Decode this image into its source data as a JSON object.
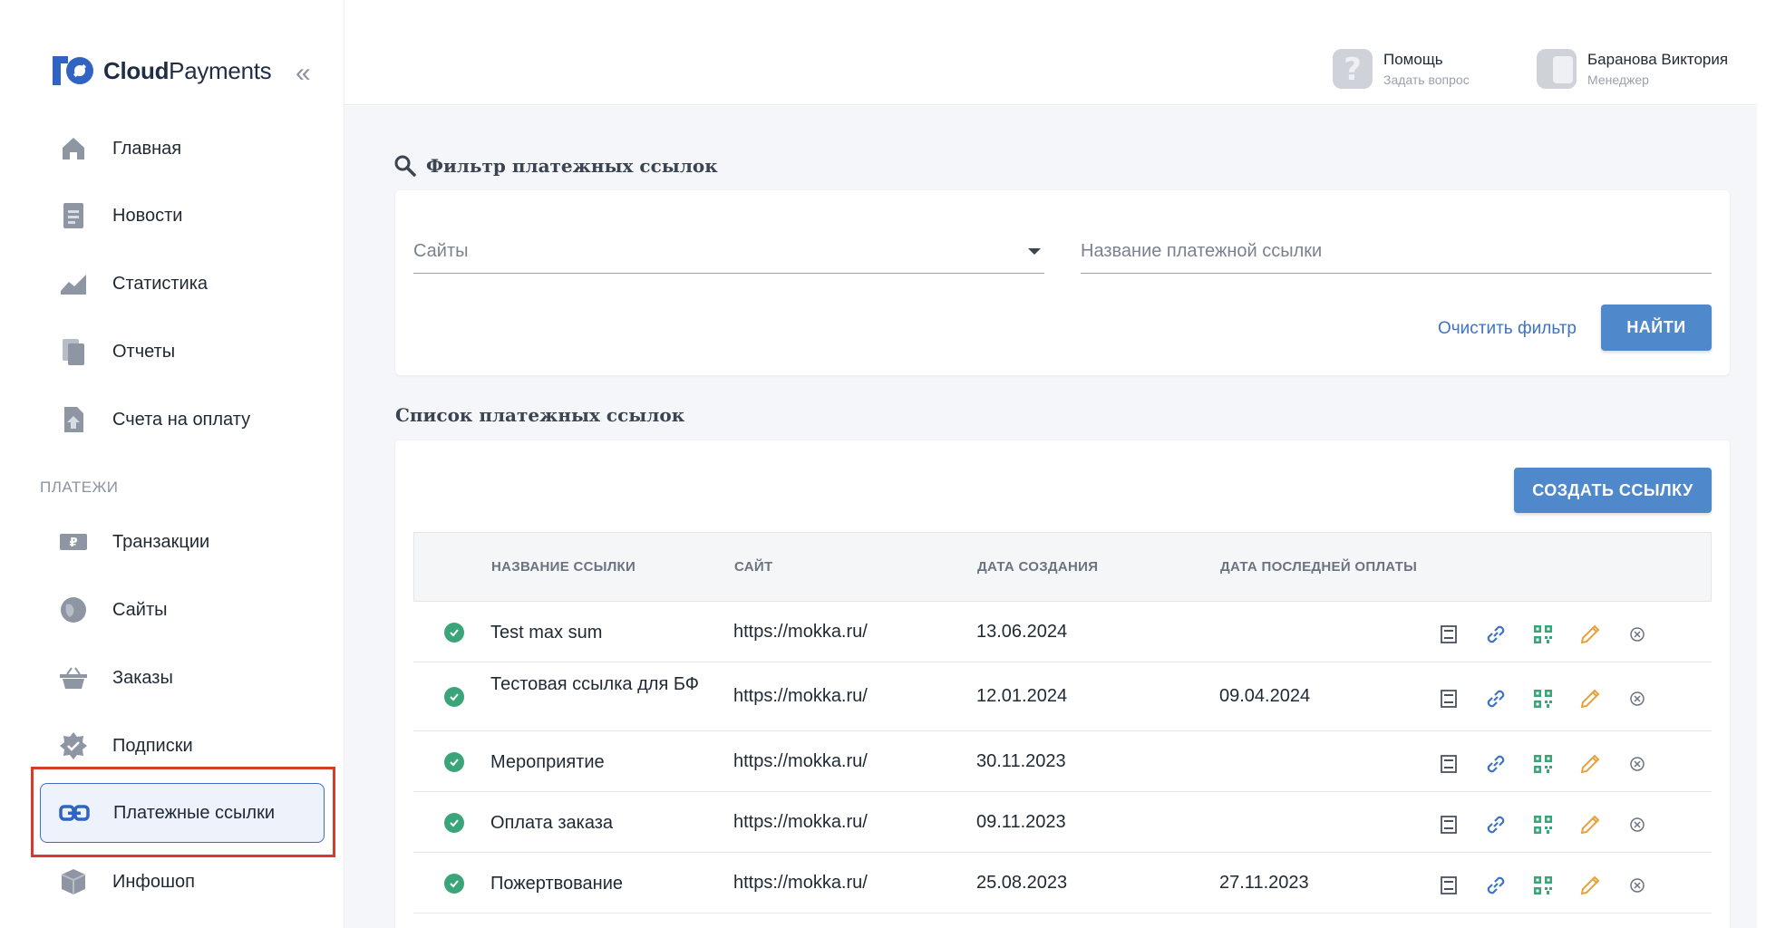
{
  "brand": {
    "name_bold": "Cloud",
    "name_regular": "Payments"
  },
  "sidebar": {
    "collapse_icon": "«",
    "items": [
      {
        "label": "Главная",
        "icon": "home-icon"
      },
      {
        "label": "Новости",
        "icon": "news-icon"
      },
      {
        "label": "Статистика",
        "icon": "chart-icon"
      },
      {
        "label": "Отчеты",
        "icon": "reports-icon"
      },
      {
        "label": "Счета на оплату",
        "icon": "invoice-icon"
      }
    ],
    "section_label": "ПЛАТЕЖИ",
    "payment_items": [
      {
        "label": "Транзакции",
        "icon": "transactions-icon"
      },
      {
        "label": "Сайты",
        "icon": "globe-icon"
      },
      {
        "label": "Заказы",
        "icon": "basket-icon"
      },
      {
        "label": "Подписки",
        "icon": "subscription-icon"
      },
      {
        "label": "Платежные ссылки",
        "icon": "link-icon",
        "active": true
      },
      {
        "label": "Инфошоп",
        "icon": "box-icon"
      }
    ]
  },
  "header": {
    "help": {
      "title": "Помощь",
      "subtitle": "Задать вопрос"
    },
    "user": {
      "name": "Баранова Виктория",
      "role": "Менеджер"
    }
  },
  "filter": {
    "title": "Фильтр платежных ссылок",
    "sites_placeholder": "Сайты",
    "name_placeholder": "Название платежной ссылки",
    "clear_label": "Очистить фильтр",
    "find_label": "НАЙТИ"
  },
  "list": {
    "title": "Список платежных ссылок",
    "create_label": "СОЗДАТЬ ССЫЛКУ",
    "columns": [
      "НАЗВАНИЕ ССЫЛКИ",
      "САЙТ",
      "ДАТА СОЗДАНИЯ",
      "ДАТА ПОСЛЕДНЕЙ ОПЛАТЫ"
    ],
    "rows": [
      {
        "name": "Test max sum",
        "site": "https://mokka.ru/",
        "created": "13.06.2024",
        "last_payment": ""
      },
      {
        "name": "Тестовая ссылка для БФ",
        "site": "https://mokka.ru/",
        "created": "12.01.2024",
        "last_payment": "09.04.2024"
      },
      {
        "name": "Мероприятие",
        "site": "https://mokka.ru/",
        "created": "30.11.2023",
        "last_payment": ""
      },
      {
        "name": "Оплата заказа",
        "site": "https://mokka.ru/",
        "created": "09.11.2023",
        "last_payment": ""
      },
      {
        "name": "Пожертвование",
        "site": "https://mokka.ru/",
        "created": "25.08.2023",
        "last_payment": "27.11.2023"
      }
    ]
  },
  "colors": {
    "accent": "#5088cc",
    "link": "#3d73c9",
    "status_green": "#3ba57a",
    "qr_green": "#3ba57a",
    "edit_orange": "#e8a13a",
    "highlight_red": "#d63b2d"
  }
}
